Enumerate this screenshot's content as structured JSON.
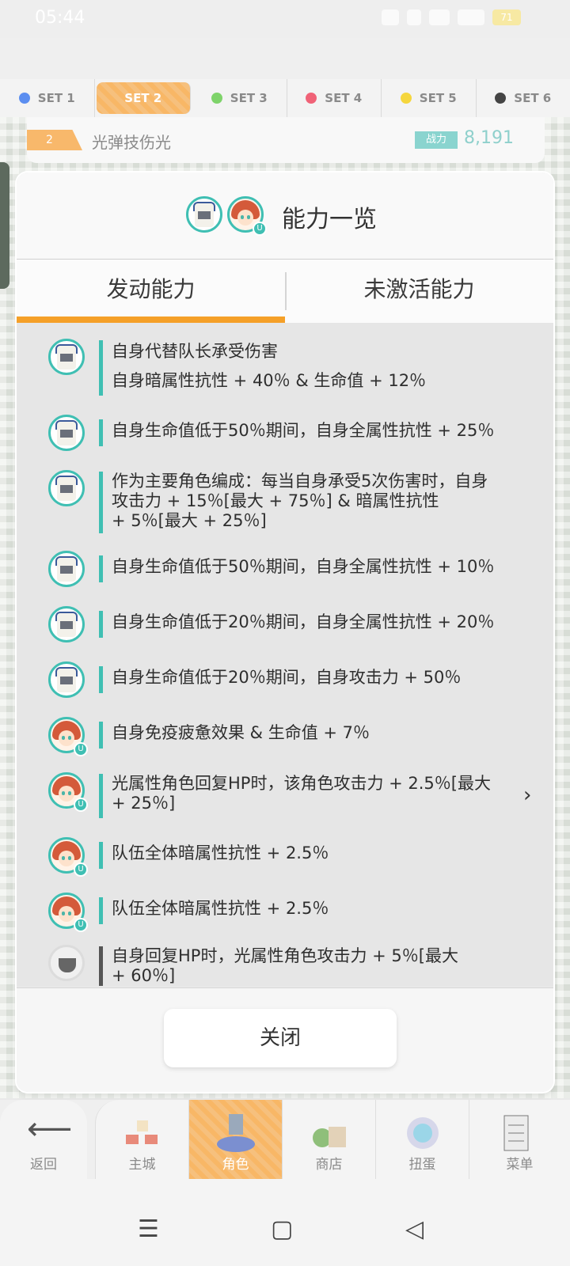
{
  "statusbar": {
    "time": "05:44",
    "battery": "71"
  },
  "set_tabs": [
    {
      "label": "SET 1",
      "color": "#5b8ef0"
    },
    {
      "label": "SET 2",
      "color": "#ffffff"
    },
    {
      "label": "SET 3",
      "color": "#7ed36a"
    },
    {
      "label": "SET 4",
      "color": "#f06277"
    },
    {
      "label": "SET 5",
      "color": "#f5d63d"
    },
    {
      "label": "SET 6",
      "color": "#444444"
    }
  ],
  "team": {
    "number": "2",
    "name": "光弹技伤光",
    "power_label": "战力",
    "power": "8,191"
  },
  "modal": {
    "title": "能力一览",
    "tabs": {
      "active": "发动能力",
      "inactive": "未激活能力"
    },
    "close_label": "关闭"
  },
  "abilities": [
    {
      "icon": "knight-avatar-icon",
      "lines": [
        "自身代替队长承受伤害",
        "自身暗属性抗性 + 40％ & 生命值 + 12％"
      ]
    },
    {
      "icon": "knight-avatar-icon",
      "lines": [
        "自身生命值低于50％期间，自身全属性抗性 + 25％"
      ]
    },
    {
      "icon": "knight-avatar-icon",
      "lines": [
        "作为主要角色编成：每当自身承受5次伤害时，自身",
        "攻击力 + 15％[最大 + 75％] & 暗属性抗性",
        "+ 5％[最大 + 25％]"
      ]
    },
    {
      "icon": "knight-avatar-icon",
      "lines": [
        "自身生命值低于50％期间，自身全属性抗性 + 10％"
      ]
    },
    {
      "icon": "knight-avatar-icon",
      "lines": [
        "自身生命值低于20％期间，自身全属性抗性 + 20％"
      ]
    },
    {
      "icon": "knight-avatar-icon",
      "lines": [
        "自身生命值低于20％期间，自身攻击力 + 50％"
      ]
    },
    {
      "icon": "girl-avatar-icon",
      "lines": [
        "自身免疫疲惫效果 & 生命值 + 7％"
      ]
    },
    {
      "icon": "girl-avatar-icon",
      "lines": [
        "光属性角色回复HP时，该角色攻击力 + 2.5％[最大",
        "+ 25％]"
      ]
    },
    {
      "icon": "girl-avatar-icon",
      "lines": [
        "队伍全体暗属性抗性 + 2.5％"
      ]
    },
    {
      "icon": "girl-avatar-icon",
      "lines": [
        "队伍全体暗属性抗性 + 2.5％"
      ]
    },
    {
      "icon": "gear-avatar-icon",
      "lines": [
        "自身回复HP时，光属性角色攻击力 + 5％[最大",
        "+ 60％]"
      ]
    }
  ],
  "bottom_nav": [
    {
      "label": "返回",
      "icon": "back-arrow-icon"
    },
    {
      "label": "主城",
      "icon": "town-icon"
    },
    {
      "label": "角色",
      "icon": "character-icon"
    },
    {
      "label": "商店",
      "icon": "shop-icon"
    },
    {
      "label": "扭蛋",
      "icon": "gacha-icon"
    },
    {
      "label": "菜单",
      "icon": "menu-icon"
    }
  ],
  "colors": {
    "accent": "#f5a028",
    "teal": "#3fbfb3"
  }
}
